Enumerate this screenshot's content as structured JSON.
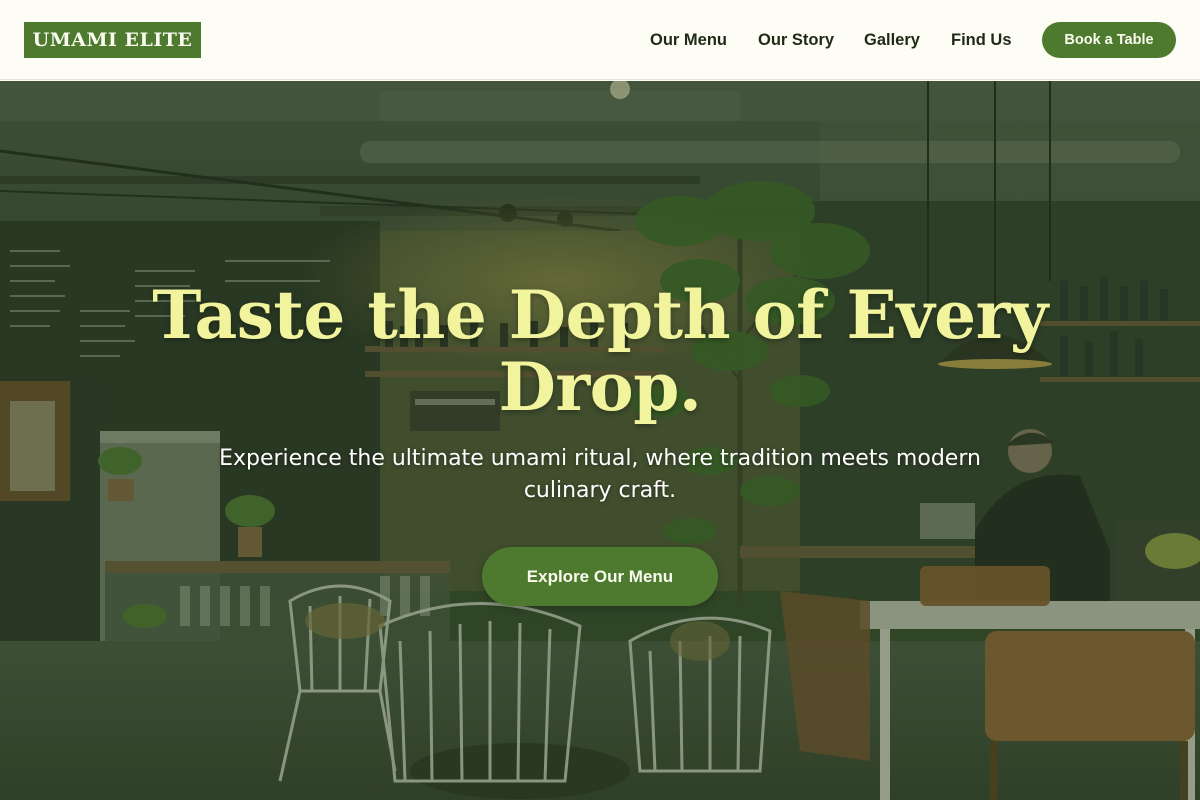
{
  "brand": {
    "name": "UMAMI ELITE",
    "accent": "#4d7a2e"
  },
  "nav": {
    "items": [
      {
        "label": "Our Menu"
      },
      {
        "label": "Our Story"
      },
      {
        "label": "Gallery"
      },
      {
        "label": "Find Us"
      }
    ],
    "cta_label": "Book a Table"
  },
  "hero": {
    "title": "Taste the Depth of Every Drop.",
    "subtitle": "Experience the ultimate umami ritual, where tradition meets modern culinary craft.",
    "cta_label": "Explore Our Menu",
    "title_color": "#f1f49c"
  }
}
